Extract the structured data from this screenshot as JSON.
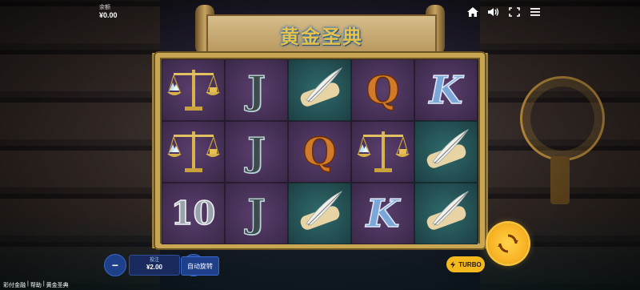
{
  "balance": {
    "label": "余额",
    "value": "¥0.00"
  },
  "title": "黄金圣典",
  "reels": [
    [
      {
        "symbol": "scales",
        "bg": "purple"
      },
      {
        "symbol": "scales",
        "bg": "purple"
      },
      {
        "symbol": "10",
        "bg": "purple"
      }
    ],
    [
      {
        "symbol": "J",
        "bg": "purple"
      },
      {
        "symbol": "J",
        "bg": "purple"
      },
      {
        "symbol": "J",
        "bg": "purple"
      }
    ],
    [
      {
        "symbol": "quill",
        "bg": "teal"
      },
      {
        "symbol": "Q",
        "bg": "purple"
      },
      {
        "symbol": "quill",
        "bg": "teal"
      }
    ],
    [
      {
        "symbol": "Q",
        "bg": "purple"
      },
      {
        "symbol": "scales",
        "bg": "purple"
      },
      {
        "symbol": "K",
        "bg": "purple"
      }
    ],
    [
      {
        "symbol": "K",
        "bg": "purple"
      },
      {
        "symbol": "quill",
        "bg": "teal"
      },
      {
        "symbol": "quill",
        "bg": "teal"
      }
    ]
  ],
  "controls": {
    "minus_label": "−",
    "plus_label": "+",
    "bet_label": "投注",
    "bet_value": "¥2.00",
    "auto_label": "自动旋转",
    "turbo_label": "TURBO"
  },
  "footer": {
    "link1": "彩付金融",
    "sep1": "|",
    "link2": "帮助",
    "sep2": "|",
    "link3": "黄金圣典"
  },
  "icons": [
    "home-icon",
    "speaker-icon",
    "fullscreen-icon",
    "menu-icon",
    "spin-icon"
  ],
  "colors": {
    "frame_gold": "#c9a653",
    "turbo_yellow": "#f2b81e",
    "spin_orange": "#f4a10e",
    "title_gold": "#e8c24a"
  }
}
